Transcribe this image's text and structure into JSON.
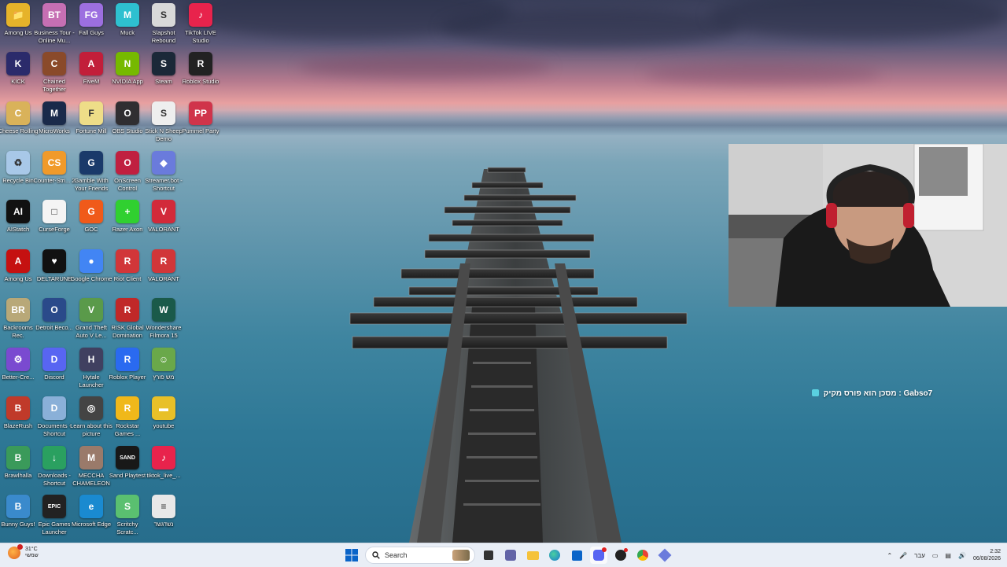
{
  "desktop_icons": [
    {
      "label": "Among Us",
      "color": "#e6b32a",
      "glyph": "📁"
    },
    {
      "label": "Business Tour - Online Mu...",
      "color": "#c66fb3",
      "glyph": "BT"
    },
    {
      "label": "Fall Guys",
      "color": "#9c6fe0",
      "glyph": "FG"
    },
    {
      "label": "Muck",
      "color": "#2ec0d0",
      "glyph": "M"
    },
    {
      "label": "Slapshot Rebound",
      "color": "#d9d9d9",
      "glyph": "S"
    },
    {
      "label": "TikTok LIVE Studio",
      "color": "#e8234c",
      "glyph": "♪"
    },
    {
      "label": "KICK",
      "color": "#2b2b6b",
      "glyph": "K"
    },
    {
      "label": "Chained Together",
      "color": "#8a4a2a",
      "glyph": "C"
    },
    {
      "label": "FiveM",
      "color": "#c21e3a",
      "glyph": "A"
    },
    {
      "label": "NVIDIA App",
      "color": "#76b900",
      "glyph": "N"
    },
    {
      "label": "Steam",
      "color": "#1b2838",
      "glyph": "S"
    },
    {
      "label": "Roblox Studio",
      "color": "#222222",
      "glyph": "R"
    },
    {
      "label": "Cheese Rolling",
      "color": "#d9b25a",
      "glyph": "C"
    },
    {
      "label": "MicroWorks",
      "color": "#1a2a4a",
      "glyph": "M"
    },
    {
      "label": "Fortune Mill",
      "color": "#eedd88",
      "glyph": "F"
    },
    {
      "label": "OBS Studio",
      "color": "#302e31",
      "glyph": "O"
    },
    {
      "label": "Stick N Sheep Demo",
      "color": "#eeeeee",
      "glyph": "S"
    },
    {
      "label": "Pummel Party",
      "color": "#d0344a",
      "glyph": "PP"
    },
    {
      "label": "Recycle Bin",
      "color": "#a8c8e8",
      "glyph": "♻"
    },
    {
      "label": "Counter-Stri... 2",
      "color": "#f09a2a",
      "glyph": "CS"
    },
    {
      "label": "Gamble With Your Friends",
      "color": "#1a3a6a",
      "glyph": "G"
    },
    {
      "label": "OnScreen Control",
      "color": "#c02040",
      "glyph": "O"
    },
    {
      "label": "Streamer.bot - Shortcut",
      "color": "#6a7bdc",
      "glyph": "◆"
    },
    {
      "label": "AIStatch",
      "color": "#111111",
      "glyph": "AI"
    },
    {
      "label": "CurseForge",
      "color": "#f4f4f4",
      "glyph": "□"
    },
    {
      "label": "GOC",
      "color": "#f05a1a",
      "glyph": "G"
    },
    {
      "label": "Razer Axon",
      "color": "#30d030",
      "glyph": "+"
    },
    {
      "label": "VALORANT",
      "color": "#d22a3a",
      "glyph": "V"
    },
    {
      "label": "Among Us",
      "color": "#c51111",
      "glyph": "A"
    },
    {
      "label": "DELTARUNE",
      "color": "#111111",
      "glyph": "♥"
    },
    {
      "label": "Google Chrome",
      "color": "#4285f4",
      "glyph": "●"
    },
    {
      "label": "Riot Client",
      "color": "#d13639",
      "glyph": "R"
    },
    {
      "label": "VALORANT",
      "color": "#d13639",
      "glyph": "R"
    },
    {
      "label": "Backrooms Rec.",
      "color": "#b8a878",
      "glyph": "BR"
    },
    {
      "label": "Detroit Beco...",
      "color": "#2a4a8a",
      "glyph": "O"
    },
    {
      "label": "Grand Theft Auto V Le...",
      "color": "#5a9a4a",
      "glyph": "V"
    },
    {
      "label": "RISK Global Domination",
      "color": "#c02828",
      "glyph": "R"
    },
    {
      "label": "Wondershare Filmora 15",
      "color": "#1a5a4a",
      "glyph": "W"
    },
    {
      "label": "Better-Cre...",
      "color": "#7a4ad0",
      "glyph": "⚙"
    },
    {
      "label": "Discord",
      "color": "#5865f2",
      "glyph": "D"
    },
    {
      "label": "Hytale Launcher",
      "color": "#404060",
      "glyph": "H"
    },
    {
      "label": "Roblox Player",
      "color": "#2a6af0",
      "glyph": "R"
    },
    {
      "label": "מש פורץ",
      "color": "#6aa84a",
      "glyph": "☺"
    },
    {
      "label": "BlazeRush",
      "color": "#c03a2a",
      "glyph": "B"
    },
    {
      "label": "Documents - Shortcut",
      "color": "#8ab0d8",
      "glyph": "D"
    },
    {
      "label": "Learn about this picture",
      "color": "#444444",
      "glyph": "◎"
    },
    {
      "label": "Rockstar Games ...",
      "color": "#f0b81a",
      "glyph": "R"
    },
    {
      "label": "youtube",
      "color": "#e8c028",
      "glyph": "▬"
    },
    {
      "label": "Brawlhalla",
      "color": "#3a9a5a",
      "glyph": "B"
    },
    {
      "label": "Downloads - Shortcut",
      "color": "#2aa060",
      "glyph": "↓"
    },
    {
      "label": "MECCHA CHAMELEON",
      "color": "#9a7a6a",
      "glyph": "M"
    },
    {
      "label": "Sand Playtest",
      "color": "#181818",
      "glyph": "SAND"
    },
    {
      "label": "tiktok_live_...",
      "color": "#e8234c",
      "glyph": "♪"
    },
    {
      "label": "Bunny Guys!",
      "color": "#3a8acc",
      "glyph": "B"
    },
    {
      "label": "Epic Games Launcher",
      "color": "#222222",
      "glyph": "EPIC"
    },
    {
      "label": "Microsoft Edge",
      "color": "#1a8ad0",
      "glyph": "e"
    },
    {
      "label": "Scritchy Scratc...",
      "color": "#5ac070",
      "glyph": "S"
    },
    {
      "label": "נשדגשד",
      "color": "#e8e8e8",
      "glyph": "≡"
    }
  ],
  "stream_overlay": {
    "text": "מסכן הוא פורס מקיק : Gabso7"
  },
  "taskbar": {
    "weather_temp": "31°C",
    "weather_desc": "שמשי",
    "search_label": "Search",
    "language": "עבר",
    "time": "2:32",
    "date": "06/08/2026",
    "accent": "#0a64c8"
  }
}
